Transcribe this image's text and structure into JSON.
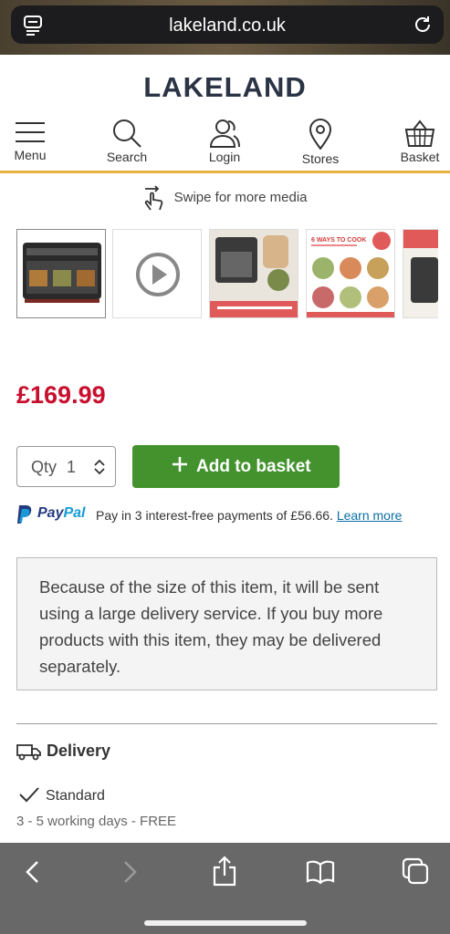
{
  "browser": {
    "url": "lakeland.co.uk",
    "icons": [
      "reader-icon",
      "reload-icon",
      "back-icon",
      "forward-icon",
      "share-icon",
      "bookmarks-icon",
      "tabs-icon"
    ]
  },
  "site": {
    "logo": "LAKELAND",
    "nav": [
      {
        "label": "Menu",
        "icon": "hamburger-icon"
      },
      {
        "label": "Search",
        "icon": "search-icon"
      },
      {
        "label": "Login",
        "icon": "user-icon"
      },
      {
        "label": "Stores",
        "icon": "location-pin-icon"
      },
      {
        "label": "Basket",
        "icon": "basket-icon"
      }
    ],
    "accent_color": "#e6b13c"
  },
  "media": {
    "swipe_hint": "Swipe for more media",
    "thumbnails": [
      "air-fryer-photo",
      "video-play",
      "air-fryer-cooking-window",
      "6 WAYS TO COOK",
      "partial-thumbnail"
    ],
    "ways_to_cook_caption": "6 WAYS TO COOK"
  },
  "product": {
    "price": "£169.99",
    "price_color": "#c8102e",
    "qty_label": "Qty",
    "qty_value": "1",
    "add_to_basket": "Add to basket",
    "button_color": "#43922e"
  },
  "paypal": {
    "brand_pay": "Pay",
    "brand_pal": "Pal",
    "text": "Pay in 3 interest-free payments of £56.66.",
    "link": "Learn more"
  },
  "notice": "Because of the size of this item, it will be sent using a large delivery service. If you buy more products with this item, they may be delivered separately.",
  "delivery": {
    "heading": "Delivery",
    "option": "Standard",
    "detail": "3 - 5 working days -  FREE"
  }
}
